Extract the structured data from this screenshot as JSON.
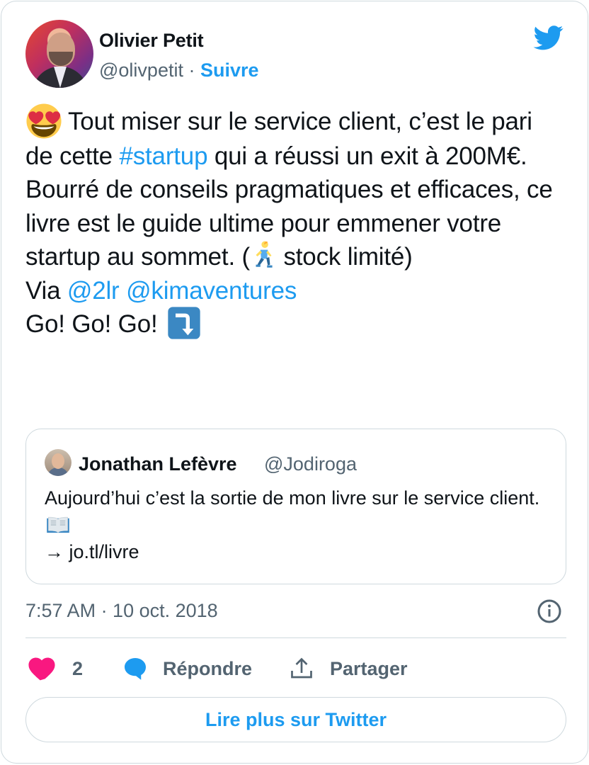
{
  "author": {
    "name": "Olivier Petit",
    "handle": "@olivpetit",
    "separator": "·",
    "follow_label": "Suivre"
  },
  "tweet": {
    "line1": "Tout miser sur le service client, c’est le pari de cette ",
    "hashtag": "#startup",
    "line1_end": " qui a réussi un exit à 200M€.",
    "line2": "Bourré de conseils pragmatiques et efficaces, ce livre est le guide ultime pour emmener votre startup au sommet. (",
    "line2_end": " stock limité)",
    "via_prefix": "Via ",
    "mention1": "@2lr",
    "mention2": "@kimaventures",
    "line_go": "Go! Go! Go!",
    "emojis": [
      "heart-eyes-emoji",
      "runner-emoji",
      "arrow-down-emoji"
    ]
  },
  "quoted": {
    "name": "Jonathan Lefèvre",
    "handle": "@Jodiroga",
    "text": "Aujourd’hui c’est la sortie de mon livre sur le service client.",
    "link_line": "→ jo.tl/livre",
    "emoji": "open-book-emoji"
  },
  "timestamp": "7:57 AM · 10 oct. 2018",
  "actions": {
    "like_count": "2",
    "reply_label": "Répondre",
    "share_label": "Partager"
  },
  "read_more_label": "Lire plus sur Twitter",
  "colors": {
    "accent": "#1d9bf0",
    "text": "#0f1419",
    "muted": "#536471",
    "border": "#cfd9de",
    "like": "#f91880"
  }
}
